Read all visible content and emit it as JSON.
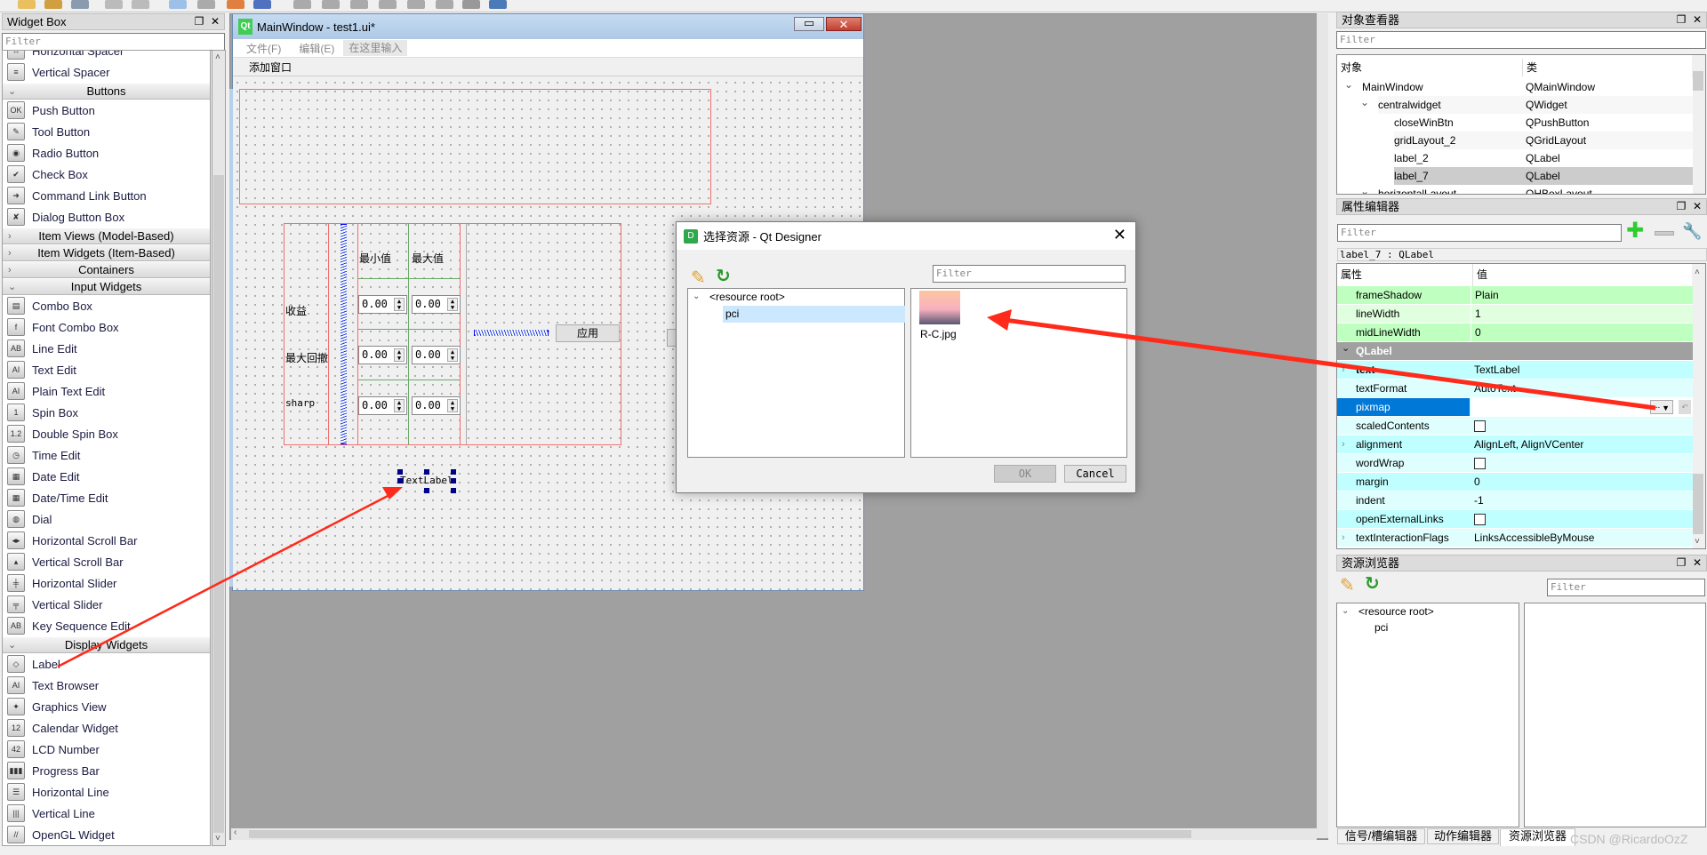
{
  "widget_box": {
    "title": "Widget Box",
    "filter_placeholder": "Filter",
    "items": [
      {
        "type": "item",
        "label": "Horizontal Spacer",
        "icon": "horizontal-spacer-icon",
        "glyph": "↔"
      },
      {
        "type": "item",
        "label": "Vertical Spacer",
        "icon": "vertical-spacer-icon",
        "glyph": "≡"
      },
      {
        "type": "category",
        "label": "Buttons",
        "expanded": true
      },
      {
        "type": "item",
        "label": "Push Button",
        "icon": "push-button-icon",
        "glyph": "OK"
      },
      {
        "type": "item",
        "label": "Tool Button",
        "icon": "tool-button-icon",
        "glyph": "✎"
      },
      {
        "type": "item",
        "label": "Radio Button",
        "icon": "radio-button-icon",
        "glyph": "◉"
      },
      {
        "type": "item",
        "label": "Check Box",
        "icon": "check-box-icon",
        "glyph": "✔"
      },
      {
        "type": "item",
        "label": "Command Link Button",
        "icon": "command-link-icon",
        "glyph": "➜"
      },
      {
        "type": "item",
        "label": "Dialog Button Box",
        "icon": "dialog-button-box-icon",
        "glyph": "✘"
      },
      {
        "type": "category",
        "label": "Item Views (Model-Based)",
        "expanded": false
      },
      {
        "type": "category",
        "label": "Item Widgets (Item-Based)",
        "expanded": false
      },
      {
        "type": "category",
        "label": "Containers",
        "expanded": false
      },
      {
        "type": "category",
        "label": "Input Widgets",
        "expanded": true
      },
      {
        "type": "item",
        "label": "Combo Box",
        "icon": "combo-box-icon",
        "glyph": "▤"
      },
      {
        "type": "item",
        "label": "Font Combo Box",
        "icon": "font-combo-box-icon",
        "glyph": "f"
      },
      {
        "type": "item",
        "label": "Line Edit",
        "icon": "line-edit-icon",
        "glyph": "AB"
      },
      {
        "type": "item",
        "label": "Text Edit",
        "icon": "text-edit-icon",
        "glyph": "AI"
      },
      {
        "type": "item",
        "label": "Plain Text Edit",
        "icon": "plain-text-edit-icon",
        "glyph": "AI"
      },
      {
        "type": "item",
        "label": "Spin Box",
        "icon": "spin-box-icon",
        "glyph": "1"
      },
      {
        "type": "item",
        "label": "Double Spin Box",
        "icon": "double-spin-box-icon",
        "glyph": "1.2"
      },
      {
        "type": "item",
        "label": "Time Edit",
        "icon": "clock-icon",
        "glyph": "◷"
      },
      {
        "type": "item",
        "label": "Date Edit",
        "icon": "calendar-icon",
        "glyph": "▦"
      },
      {
        "type": "item",
        "label": "Date/Time Edit",
        "icon": "datetime-icon",
        "glyph": "▦"
      },
      {
        "type": "item",
        "label": "Dial",
        "icon": "dial-icon",
        "glyph": "◍"
      },
      {
        "type": "item",
        "label": "Horizontal Scroll Bar",
        "icon": "horizontal-scroll-bar-icon",
        "glyph": "◂▸"
      },
      {
        "type": "item",
        "label": "Vertical Scroll Bar",
        "icon": "vertical-scroll-bar-icon",
        "glyph": "▴"
      },
      {
        "type": "item",
        "label": "Horizontal Slider",
        "icon": "horizontal-slider-icon",
        "glyph": "╪"
      },
      {
        "type": "item",
        "label": "Vertical Slider",
        "icon": "vertical-slider-icon",
        "glyph": "╤"
      },
      {
        "type": "item",
        "label": "Key Sequence Edit",
        "icon": "key-sequence-edit-icon",
        "glyph": "AB"
      },
      {
        "type": "category",
        "label": "Display Widgets",
        "expanded": true
      },
      {
        "type": "item",
        "label": "Label",
        "icon": "label-tag-icon",
        "glyph": "◇"
      },
      {
        "type": "item",
        "label": "Text Browser",
        "icon": "text-browser-icon",
        "glyph": "AI"
      },
      {
        "type": "item",
        "label": "Graphics View",
        "icon": "graphics-view-icon",
        "glyph": "✦"
      },
      {
        "type": "item",
        "label": "Calendar Widget",
        "icon": "calendar-widget-icon",
        "glyph": "12"
      },
      {
        "type": "item",
        "label": "LCD Number",
        "icon": "lcd-number-icon",
        "glyph": "42"
      },
      {
        "type": "item",
        "label": "Progress Bar",
        "icon": "progress-bar-icon",
        "glyph": "▮▮▮"
      },
      {
        "type": "item",
        "label": "Horizontal Line",
        "icon": "horizontal-line-icon",
        "glyph": "☰"
      },
      {
        "type": "item",
        "label": "Vertical Line",
        "icon": "vertical-line-icon",
        "glyph": "|||"
      },
      {
        "type": "item",
        "label": "OpenGL Widget",
        "icon": "opengl-widget-icon",
        "glyph": "//"
      }
    ]
  },
  "form": {
    "title": "MainWindow - test1.ui*",
    "menu": [
      "文件(F)",
      "编辑(E)",
      "在这里输入"
    ],
    "toolbar_action": "添加窗口",
    "col_headers": [
      "最小值",
      "最大值"
    ],
    "row_labels": [
      "收益",
      "最大回撤",
      "sharp"
    ],
    "spin_values": [
      [
        "0.00",
        "0.00"
      ],
      [
        "0.00",
        "0.00"
      ],
      [
        "0.00",
        "0.00"
      ]
    ],
    "apply_button": "应用",
    "text_label": "TextLabel"
  },
  "dialog": {
    "title": "选择资源 - Qt Designer",
    "filter_placeholder": "Filter",
    "tree": {
      "root": "<resource root>",
      "child": "pci"
    },
    "file": "R-C.jpg",
    "ok": "OK",
    "cancel": "Cancel"
  },
  "object_inspector": {
    "title": "对象查看器",
    "filter_placeholder": "Filter",
    "headers": [
      "对象",
      "类"
    ],
    "rows": [
      {
        "name": "MainWindow",
        "class": "QMainWindow",
        "level": 0,
        "expanded": true
      },
      {
        "name": "centralwidget",
        "class": "QWidget",
        "level": 1,
        "expanded": true
      },
      {
        "name": "closeWinBtn",
        "class": "QPushButton",
        "level": 2
      },
      {
        "name": "gridLayout_2",
        "class": "QGridLayout",
        "level": 2
      },
      {
        "name": "label_2",
        "class": "QLabel",
        "level": 2
      },
      {
        "name": "label_7",
        "class": "QLabel",
        "level": 2,
        "selected": true
      },
      {
        "name": "horizontalLayout",
        "class": "QHBoxLayout",
        "level": 1,
        "expanded": true
      }
    ]
  },
  "property_editor": {
    "title": "属性编辑器",
    "filter_placeholder": "Filter",
    "object_line": "label_7 : QLabel",
    "headers": [
      "属性",
      "值"
    ],
    "section": "QLabel",
    "frame_rows": [
      {
        "name": "frameShadow",
        "value": "Plain"
      },
      {
        "name": "lineWidth",
        "value": "1"
      },
      {
        "name": "midLineWidth",
        "value": "0"
      }
    ],
    "label_rows": [
      {
        "name": "text",
        "value": "TextLabel",
        "expandable": true,
        "bold": true
      },
      {
        "name": "textFormat",
        "value": "AutoText"
      },
      {
        "name": "pixmap",
        "value": "",
        "selected": true
      },
      {
        "name": "scaledContents",
        "value": "",
        "checkbox": true
      },
      {
        "name": "alignment",
        "value": "AlignLeft, AlignVCenter",
        "expandable": true
      },
      {
        "name": "wordWrap",
        "value": "",
        "checkbox": true
      },
      {
        "name": "margin",
        "value": "0"
      },
      {
        "name": "indent",
        "value": "-1"
      },
      {
        "name": "openExternalLinks",
        "value": "",
        "checkbox": true
      },
      {
        "name": "textInteractionFlags",
        "value": "LinksAccessibleByMouse",
        "expandable": true
      }
    ],
    "pixmap_browse": "...",
    "colors": {
      "frame_a": "#bfffbf",
      "frame_b": "#dfffdf",
      "label_a": "#bfffff",
      "label_b": "#dfffff",
      "section": "#a0a0a0",
      "selected": "#0078d7"
    }
  },
  "resource_browser": {
    "title": "资源浏览器",
    "filter_placeholder": "Filter",
    "tree": {
      "root": "<resource root>",
      "child": "pci"
    }
  },
  "bottom_tabs": [
    "信号/槽编辑器",
    "动作编辑器",
    "资源浏览器"
  ],
  "watermark": "CSDN @RicardoOzZ",
  "annotation_color": "#ff2a1a"
}
